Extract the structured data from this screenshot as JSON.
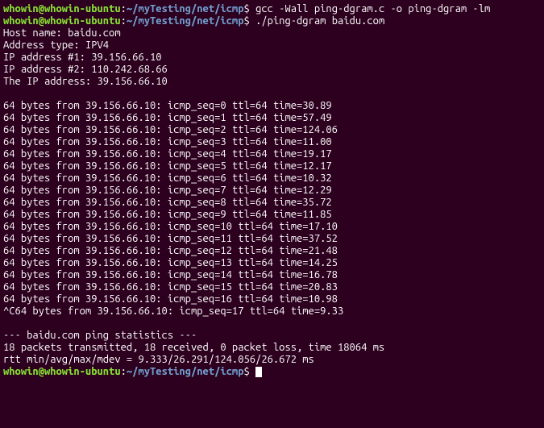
{
  "prompt": {
    "user": "whowin@whowin-ubuntu",
    "colon": ":",
    "path": "~/myTesting/net/icmp",
    "dollar": "$ "
  },
  "cmd1": "gcc -Wall ping-dgram.c -o ping-dgram -lm",
  "cmd2": "./ping-dgram baidu.com",
  "header": {
    "host": "Host name: baidu.com",
    "addrtype": "Address type: IPV4",
    "ip1": "IP address #1: 39.156.66.10",
    "ip2": "IP address #2: 110.242.68.66",
    "theip": "The IP address: 39.156.66.10"
  },
  "blank": " ",
  "pings": [
    "64 bytes from 39.156.66.10: icmp_seq=0 ttl=64 time=30.89",
    "64 bytes from 39.156.66.10: icmp_seq=1 ttl=64 time=57.49",
    "64 bytes from 39.156.66.10: icmp_seq=2 ttl=64 time=124.06",
    "64 bytes from 39.156.66.10: icmp_seq=3 ttl=64 time=11.00",
    "64 bytes from 39.156.66.10: icmp_seq=4 ttl=64 time=19.17",
    "64 bytes from 39.156.66.10: icmp_seq=5 ttl=64 time=12.17",
    "64 bytes from 39.156.66.10: icmp_seq=6 ttl=64 time=10.32",
    "64 bytes from 39.156.66.10: icmp_seq=7 ttl=64 time=12.29",
    "64 bytes from 39.156.66.10: icmp_seq=8 ttl=64 time=35.72",
    "64 bytes from 39.156.66.10: icmp_seq=9 ttl=64 time=11.85",
    "64 bytes from 39.156.66.10: icmp_seq=10 ttl=64 time=17.10",
    "64 bytes from 39.156.66.10: icmp_seq=11 ttl=64 time=37.52",
    "64 bytes from 39.156.66.10: icmp_seq=12 ttl=64 time=21.48",
    "64 bytes from 39.156.66.10: icmp_seq=13 ttl=64 time=14.25",
    "64 bytes from 39.156.66.10: icmp_seq=14 ttl=64 time=16.78",
    "64 bytes from 39.156.66.10: icmp_seq=15 ttl=64 time=20.83",
    "64 bytes from 39.156.66.10: icmp_seq=16 ttl=64 time=10.98",
    "^C64 bytes from 39.156.66.10: icmp_seq=17 ttl=64 time=9.33"
  ],
  "stats": {
    "header": "--- baidu.com ping statistics ---",
    "packets": "18 packets transmitted, 18 received, 0 packet loss, time 18064 ms",
    "rtt": "rtt min/avg/max/mdev = 9.333/26.291/124.056/26.672 ms"
  }
}
